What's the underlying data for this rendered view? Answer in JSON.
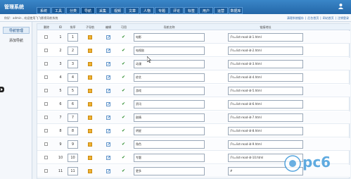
{
  "app": {
    "brand": "管理系统",
    "nav_tabs": [
      "系统",
      "工具",
      "分类",
      "导航",
      "采集",
      "视频",
      "文章",
      "人物",
      "专题",
      "评论",
      "标签",
      "用户",
      "运营",
      "数据库"
    ],
    "active_tab_index": 3
  },
  "infobar": {
    "crumb": "你好：admin , 欢迎使用飞飞影视导航系统",
    "quick_links": [
      "清理系统缓存",
      "后台首页",
      "网站首页",
      "注销登录"
    ]
  },
  "sidebar": {
    "items": [
      "导航管理",
      "添加导航"
    ],
    "active_index": 0
  },
  "table": {
    "headers": [
      "删除",
      "ID",
      "排序",
      "子导航",
      "编辑",
      "可用",
      "导航名称",
      "链接地址"
    ],
    "rows": [
      {
        "id": "1",
        "sort": "1",
        "name": "电影",
        "link": "/?s=list-read-id-1.html"
      },
      {
        "id": "2",
        "sort": "2",
        "name": "电视剧",
        "link": "/?s=list-read-id-2.html"
      },
      {
        "id": "3",
        "sort": "3",
        "name": "动漫",
        "link": "/?s=list-read-id-3.html"
      },
      {
        "id": "4",
        "sort": "4",
        "name": "综艺",
        "link": "/?s=list-read-id-4.html"
      },
      {
        "id": "5",
        "sort": "5",
        "name": "游戏",
        "link": "/?s=list-read-id-5.html"
      },
      {
        "id": "6",
        "sort": "6",
        "name": "资讯",
        "link": "/?s=list-read-id-6.html"
      },
      {
        "id": "7",
        "sort": "7",
        "name": "剧情",
        "link": "/?s=list-read-id-7.html"
      },
      {
        "id": "8",
        "sort": "8",
        "name": "明星",
        "link": "/?s=list-read-id-8.html"
      },
      {
        "id": "9",
        "sort": "9",
        "name": "角色",
        "link": "/?s=list-read-id-9.html"
      },
      {
        "id": "10",
        "sort": "10",
        "name": "专题",
        "link": "/?s=list-read-id-10.html"
      },
      {
        "id": "11",
        "sort": "11",
        "name": "更多",
        "link": "#"
      }
    ]
  },
  "watermark": {
    "text": "pc6",
    "logo_color": "#2c8fd6"
  },
  "icons": {
    "sub_nav": "subnav-icon",
    "edit": "edit-icon",
    "enabled": "check-icon",
    "user": "user-icon",
    "collapse": "collapse-arrow-icon"
  },
  "colors": {
    "topbar": "#2467a8",
    "accent": "#2a64a8",
    "check": "#2a8b2a",
    "subnav": "#f0b233"
  }
}
